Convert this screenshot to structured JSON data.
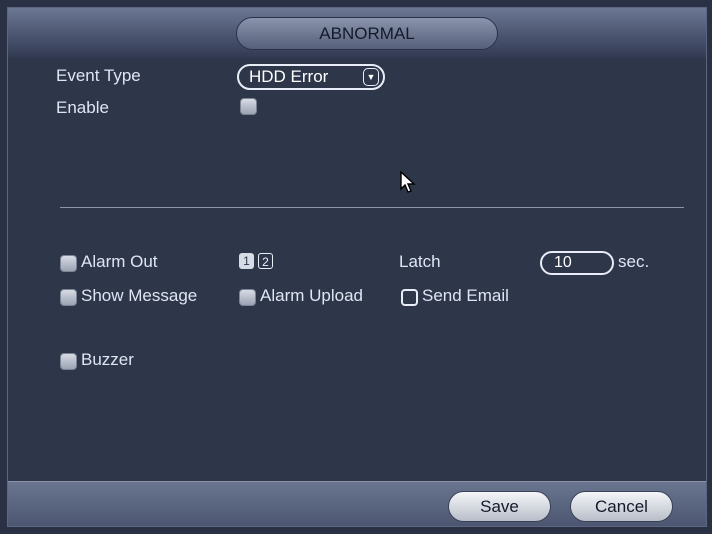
{
  "title": "ABNORMAL",
  "form": {
    "event_type_label": "Event Type",
    "event_type_value": "HDD Error",
    "enable_label": "Enable",
    "enable_checked": false
  },
  "options": {
    "alarm_out_label": "Alarm Out",
    "alarm_out_channels": [
      "1",
      "2"
    ],
    "latch_label": "Latch",
    "latch_value": "10",
    "latch_unit": "sec.",
    "show_message_label": "Show Message",
    "alarm_upload_label": "Alarm Upload",
    "send_email_label": "Send Email",
    "buzzer_label": "Buzzer"
  },
  "buttons": {
    "save": "Save",
    "cancel": "Cancel"
  },
  "icons": {
    "dropdown": "chevron-down-icon",
    "cursor": "mouse-pointer-icon"
  }
}
